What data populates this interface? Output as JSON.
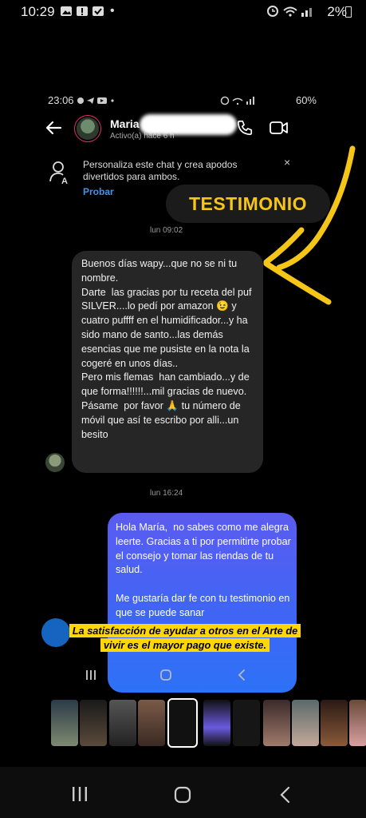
{
  "outer_status": {
    "time": "10:29",
    "dot": "•",
    "battery": "2%"
  },
  "inner_status": {
    "time": "23:06",
    "battery": "60%"
  },
  "header": {
    "name": "Maria",
    "subtitle": "Activo(a) hace 6 h"
  },
  "banner": {
    "text": "Personaliza este chat y crea apodos divertidos para ambos.",
    "link": "Probar",
    "close": "×"
  },
  "badge": {
    "label": "TESTIMONIO"
  },
  "messages": [
    {
      "day": "lun 09:02",
      "direction": "incoming",
      "text": "Buenos días wapy...que no se ni tu nombre.\nDarte  las gracias por tu receta del puf SILVER....lo pedí por amazon 😉 y cuatro puffff en el humidificador...y ha sido mano de santo...las demás esencias que me pusiste en la nota la cogeré en unos días..\nPero mis flemas  han cambiado...y de que forma!!!!!!...mil gracias de nuevo.\nPásame  por favor 🙏 tu número de móvil que así te escribo por alli...un besito"
    },
    {
      "day": "lun 16:24",
      "direction": "outgoing",
      "text": "Hola María,  no sabes como me alegra leerte. Gracias a ti por permitirte probar el consejo y tomar las riendas de tu salud.\n\nMe gustaría dar fe con tu testimonio en que se puede sanar"
    }
  ],
  "caption": {
    "line1": "La satisfacción de ayudar a otros en el Arte de",
    "line2": "vivir es el mayor pago que existe."
  },
  "colors": {
    "accent_yellow": "#f5c518",
    "caption_bg": "#ffd60a",
    "bubble_in": "#262626",
    "bubble_out_top": "#5b5cf0",
    "bubble_out_bottom": "#2d72f7",
    "link": "#4a90e2"
  },
  "nav_icons": [
    "recent-apps-icon",
    "home-icon",
    "back-icon"
  ]
}
